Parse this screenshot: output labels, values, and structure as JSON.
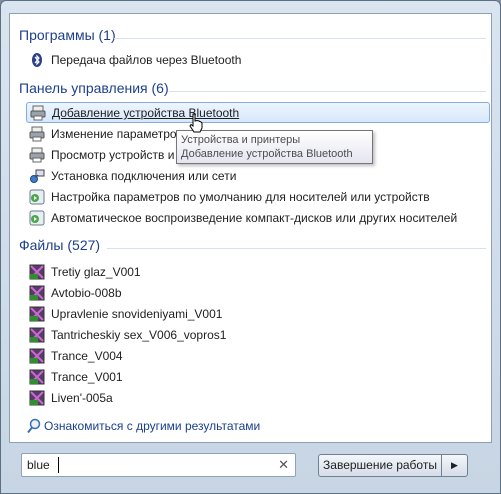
{
  "programs": {
    "header": "Программы (1)",
    "items": [
      {
        "label": "Передача файлов через Bluetooth",
        "icon": "bluetooth-icon"
      }
    ]
  },
  "control_panel": {
    "header": "Панель управления (6)",
    "items": [
      {
        "label": "Добавление устройства Bluetooth",
        "icon": "printer-device-icon",
        "selected": true
      },
      {
        "label": "Изменение параметров",
        "icon": "printer-device-icon"
      },
      {
        "label": "Просмотр устройств и",
        "icon": "printer-device-icon"
      },
      {
        "label": "Установка подключения или сети",
        "icon": "network-icon"
      },
      {
        "label": "Настройка параметров по умолчанию для носителей или устройств",
        "icon": "autoplay-icon"
      },
      {
        "label": "Автоматическое воспроизведение компакт-дисков или других носителей",
        "icon": "autoplay-icon"
      }
    ]
  },
  "tooltip": {
    "line1": "Устройства и принтеры",
    "line2": "Добавление устройства Bluetooth"
  },
  "files": {
    "header": "Файлы (527)",
    "items": [
      {
        "label": "Tretiy glaz_V001",
        "icon": "video-file-icon"
      },
      {
        "label": "Avtobio-008b",
        "icon": "video-file-icon"
      },
      {
        "label": "Upravlenie snovideniyami_V001",
        "icon": "video-file-icon"
      },
      {
        "label": "Tantricheskiy sex_V006_vopros1",
        "icon": "video-file-icon"
      },
      {
        "label": "Trance_V004",
        "icon": "video-file-icon"
      },
      {
        "label": "Trance_V001",
        "icon": "video-file-icon"
      },
      {
        "label": "Liven'-005a",
        "icon": "video-file-icon"
      }
    ]
  },
  "see_more": {
    "label": "Ознакомиться с другими результатами",
    "icon": "search-icon"
  },
  "search": {
    "value": "blue",
    "clear_icon": "clear-icon"
  },
  "shutdown": {
    "label": "Завершение работы",
    "arrow_icon": "triangle-right-icon"
  },
  "colors": {
    "header": "#1e3f8c",
    "selection": "#d6e8fb",
    "link": "#1a3f8d"
  }
}
